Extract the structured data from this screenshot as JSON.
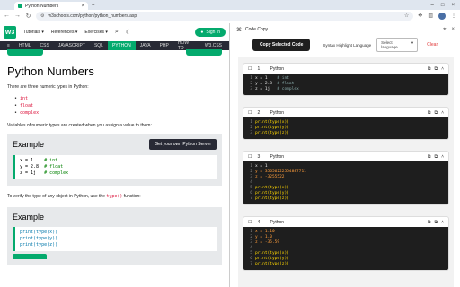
{
  "browser": {
    "tab_title": "Python Numbers",
    "url": "w3schools.com/python/python_numbers.asp"
  },
  "site": {
    "logo": "W3",
    "menu": [
      "Tutorials ▾",
      "References ▾",
      "Exercises ▾"
    ],
    "signin": "Sign In",
    "nav": [
      "HTML",
      "CSS",
      "JAVASCRIPT",
      "SQL",
      "PYTHON",
      "JAVA",
      "PHP",
      "HOW TO",
      "W3.CSS"
    ],
    "active_nav": "PYTHON"
  },
  "article": {
    "title": "Python Numbers",
    "intro": "There are three numeric types in Python:",
    "types": [
      "int",
      "float",
      "complex"
    ],
    "vars_text": "Variables of numeric types are created when you assign a value to them:",
    "example1": {
      "title": "Example",
      "button": "Get your own Python Server",
      "lines": [
        {
          "code": "x = 1    ",
          "comment": "# int"
        },
        {
          "code": "y = 2.8  ",
          "comment": "# float"
        },
        {
          "code": "z = 1j   ",
          "comment": "# complex"
        }
      ]
    },
    "verify_pre": "To verify the type of any object in Python, use the ",
    "verify_fn": "type()",
    "verify_post": " function:",
    "example2": {
      "title": "Example",
      "lines": [
        "print(type(x))",
        "print(type(y))",
        "print(type(z))"
      ]
    }
  },
  "panel": {
    "title": "Code Copy",
    "copy_selected": "Copy Selected Code",
    "lang_label": "Syntax Highlight Language",
    "lang_placeholder": "Select language...",
    "clear": "Clear",
    "snippets": [
      {
        "num": "1",
        "lang": "Python",
        "lines": [
          {
            "n": "1",
            "code": "x = 1    ",
            "comment": "# int"
          },
          {
            "n": "2",
            "code": "y = 2.8  ",
            "comment": "# float"
          },
          {
            "n": "3",
            "code": "z = 1j   ",
            "comment": "# complex"
          }
        ]
      },
      {
        "num": "2",
        "lang": "Python",
        "lines": [
          {
            "n": "1",
            "code": "print(type(x))",
            "comment": ""
          },
          {
            "n": "2",
            "code": "print(type(y))",
            "comment": ""
          },
          {
            "n": "3",
            "code": "print(type(z))",
            "comment": ""
          }
        ]
      },
      {
        "num": "3",
        "lang": "Python",
        "lines": [
          {
            "n": "1",
            "code": "x = 1",
            "comment": ""
          },
          {
            "n": "2",
            "code": "y = 35656222554887711",
            "comment": ""
          },
          {
            "n": "3",
            "code": "z = -3255522",
            "comment": ""
          },
          {
            "n": "4",
            "code": "",
            "comment": ""
          },
          {
            "n": "5",
            "code": "print(type(x))",
            "comment": ""
          },
          {
            "n": "6",
            "code": "print(type(y))",
            "comment": ""
          },
          {
            "n": "7",
            "code": "print(type(z))",
            "comment": ""
          }
        ]
      },
      {
        "num": "4",
        "lang": "Python",
        "lines": [
          {
            "n": "1",
            "code": "x = 1.10",
            "comment": ""
          },
          {
            "n": "2",
            "code": "y = 1.0",
            "comment": ""
          },
          {
            "n": "3",
            "code": "z = -35.59",
            "comment": ""
          },
          {
            "n": "4",
            "code": "",
            "comment": ""
          },
          {
            "n": "5",
            "code": "print(type(x))",
            "comment": ""
          },
          {
            "n": "6",
            "code": "print(type(y))",
            "comment": ""
          },
          {
            "n": "7",
            "code": "print(type(z))",
            "comment": ""
          }
        ]
      }
    ]
  },
  "colors": {
    "brand": "#04aa6d",
    "dark": "#282a35",
    "danger": "#e03a3a"
  },
  "icons": [
    "back-icon",
    "forward-icon",
    "reload-icon",
    "search-icon",
    "moon-icon",
    "star-icon",
    "extensions-icon",
    "copy-icon",
    "chevron-up-icon",
    "close-icon"
  ]
}
